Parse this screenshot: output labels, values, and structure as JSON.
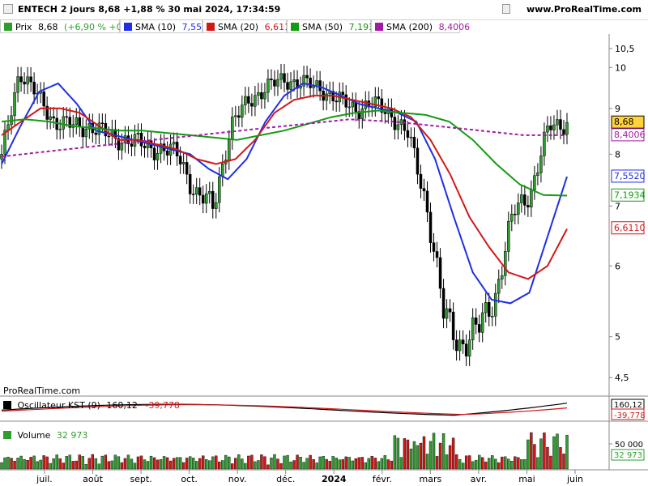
{
  "header": {
    "title": "ENTECH 2 jours 8,68 +1,88 % 30 mai 2024, 17:34:59",
    "brand": "www.ProRealTime.com"
  },
  "legend": [
    {
      "name": "Prix",
      "value": "8,68",
      "extra": "(+6,90 % +0,56)",
      "color": "#2f9e2f",
      "extra_color": "#2f9e2f"
    },
    {
      "name": "SMA (10)",
      "value": "7,5520",
      "color": "#1f2fe6",
      "extra": ""
    },
    {
      "name": "SMA (20)",
      "value": "6,6110",
      "color": "#d11818",
      "extra": ""
    },
    {
      "name": "SMA (50)",
      "value": "7,1934",
      "color": "#139b13",
      "extra": ""
    },
    {
      "name": "SMA (200)",
      "value": "8,4006",
      "color": "#a31aa3",
      "extra": ""
    }
  ],
  "watermark": "ProRealTime.com",
  "oscillator": {
    "label": "Oscillateur KST (9)",
    "value1": "160,12",
    "value2": "-39,778"
  },
  "volume": {
    "label": "Volume",
    "value": "32 973",
    "tick": "50 000"
  },
  "colors": {
    "sma10": "#1f2fe6",
    "sma20": "#d11818",
    "sma50": "#139b13",
    "sma200": "#a31aa3",
    "up": "#2f9e2f",
    "down": "#d11818",
    "kst": "#000000",
    "kst_signal": "#d11818"
  },
  "chart_data": {
    "type": "line",
    "title": "ENTECH 2 jours",
    "y_scale": "log",
    "ylim": [
      4.3,
      10.9
    ],
    "y_ticks": [
      "10,5",
      "10",
      "9",
      "8",
      "7",
      "6",
      "5",
      "4,5"
    ],
    "x_labels": [
      "juil.",
      "août",
      "sept.",
      "oct.",
      "nov.",
      "déc.",
      "2024",
      "févr.",
      "mars",
      "avr.",
      "mai",
      "juin"
    ],
    "series": [
      {
        "name": "SMA (10)",
        "last_value": "7,5520",
        "points": [
          7.8,
          8.6,
          9.4,
          9.6,
          9.1,
          8.5,
          8.4,
          8.3,
          8.2,
          8.1,
          8.0,
          7.7,
          7.5,
          7.9,
          8.7,
          9.3,
          9.6,
          9.5,
          9.3,
          9.1,
          9.0,
          8.9,
          8.7,
          7.9,
          6.8,
          5.9,
          5.5,
          5.45,
          5.6,
          6.5,
          7.55
        ]
      },
      {
        "name": "SMA (20)",
        "last_value": "6,6110",
        "points": [
          8.4,
          8.7,
          9.0,
          9.0,
          8.9,
          8.6,
          8.3,
          8.3,
          8.2,
          8.1,
          7.9,
          7.8,
          7.9,
          8.3,
          8.9,
          9.2,
          9.3,
          9.3,
          9.2,
          9.1,
          9.0,
          8.8,
          8.3,
          7.6,
          6.8,
          6.3,
          5.9,
          5.8,
          6.0,
          6.6
        ]
      },
      {
        "name": "SMA (50)",
        "last_value": "7,1934",
        "points": [
          8.7,
          8.75,
          8.7,
          8.6,
          8.55,
          8.5,
          8.5,
          8.45,
          8.4,
          8.35,
          8.3,
          8.4,
          8.5,
          8.65,
          8.8,
          8.9,
          8.95,
          8.9,
          8.85,
          8.7,
          8.3,
          7.8,
          7.4,
          7.2,
          7.19
        ]
      },
      {
        "name": "SMA (200)",
        "last_value": "8,4006",
        "points": [
          7.95,
          8.05,
          8.15,
          8.25,
          8.35,
          8.45,
          8.55,
          8.65,
          8.75,
          8.7,
          8.6,
          8.5,
          8.4,
          8.4
        ]
      }
    ],
    "price_last": "8,68",
    "price_values": [
      7.9,
      9.9,
      9.3,
      8.7,
      8.6,
      8.6,
      8.4,
      8.3,
      8.2,
      8.1,
      8.0,
      7.2,
      7.0,
      8.6,
      9.2,
      9.5,
      9.7,
      9.6,
      9.5,
      9.2,
      9.0,
      9.1,
      8.9,
      8.4,
      7.1,
      5.3,
      4.9,
      5.1,
      5.6,
      6.9,
      7.3,
      8.6,
      8.68
    ]
  }
}
